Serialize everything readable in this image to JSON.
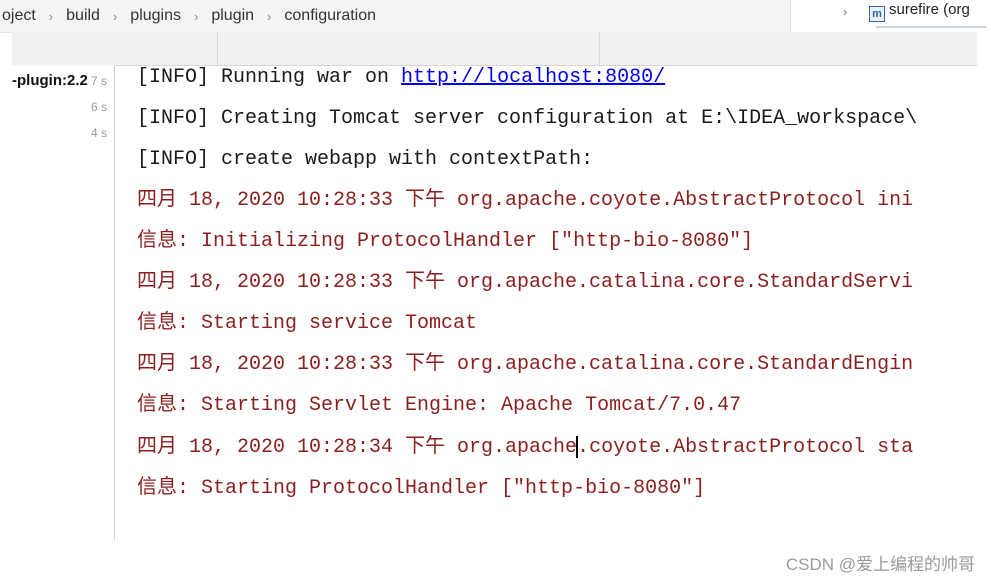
{
  "breadcrumb": [
    "oject",
    "build",
    "plugins",
    "plugin",
    "configuration"
  ],
  "right_panel": {
    "chevron": "›",
    "icon": "m",
    "node": "surefire (org"
  },
  "run_panel": {
    "label": "-plugin:2.2",
    "times": [
      "7 s",
      "6 s",
      "4 s"
    ]
  },
  "console": {
    "l1_prefix": "[INFO] Running war on ",
    "l1_link": "http://localhost:8080/",
    "l2": "[INFO] Creating Tomcat server configuration at E:\\IDEA_workspace\\",
    "l3": "[INFO] create webapp with contextPath:",
    "l4": "四月 18, 2020 10:28:33 下午 org.apache.coyote.AbstractProtocol ini",
    "l5": "信息: Initializing ProtocolHandler [\"http-bio-8080\"]",
    "l6": "四月 18, 2020 10:28:33 下午 org.apache.catalina.core.StandardServi",
    "l7": "信息: Starting service Tomcat",
    "l8": "四月 18, 2020 10:28:33 下午 org.apache.catalina.core.StandardEngin",
    "l9": "信息: Starting Servlet Engine: Apache Tomcat/7.0.47",
    "l10_a": "四月 18, 2020 10:28:34 下午 org.apache",
    "l10_b": ".coyote.AbstractProtocol sta",
    "l11": "信息: Starting ProtocolHandler [\"http-bio-8080\"]"
  },
  "watermark": "CSDN @爱上编程的帅哥",
  "colors": {
    "info_text": "#1a1a1a",
    "log_red": "#8b1e1e",
    "link": "#0000ee"
  }
}
